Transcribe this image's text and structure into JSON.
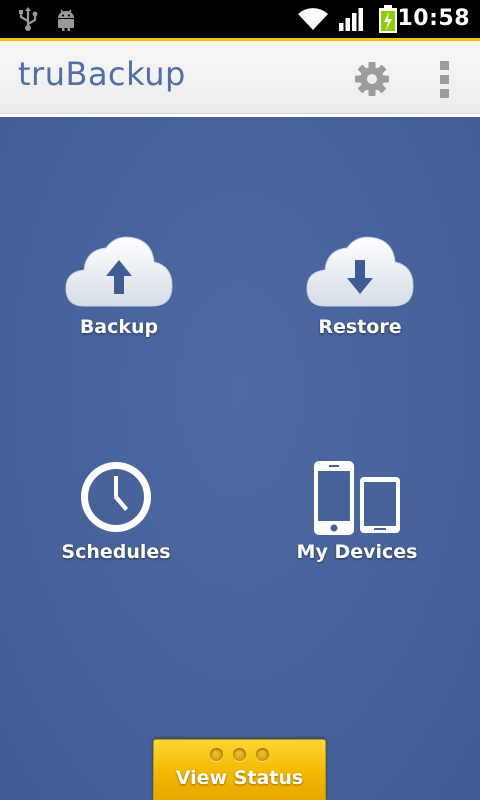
{
  "status_bar": {
    "time": "10:58",
    "icons": [
      "usb-icon",
      "android-debug-icon",
      "wifi-icon",
      "signal-icon",
      "battery-charging-icon"
    ]
  },
  "action_bar": {
    "title": "truBackup",
    "actions": [
      "settings-gear-icon",
      "overflow-menu-icon"
    ]
  },
  "tiles": [
    {
      "label": "Backup",
      "icon": "cloud-upload-icon"
    },
    {
      "label": "Restore",
      "icon": "cloud-download-icon"
    },
    {
      "label": "Schedules",
      "icon": "clock-icon"
    },
    {
      "label": "My Devices",
      "icon": "devices-icon"
    }
  ],
  "view_status": {
    "label": "View Status"
  },
  "colors": {
    "accent": "#f2c200",
    "title": "#4f6fa6",
    "background": "#46639a",
    "button": "#f4b800"
  }
}
